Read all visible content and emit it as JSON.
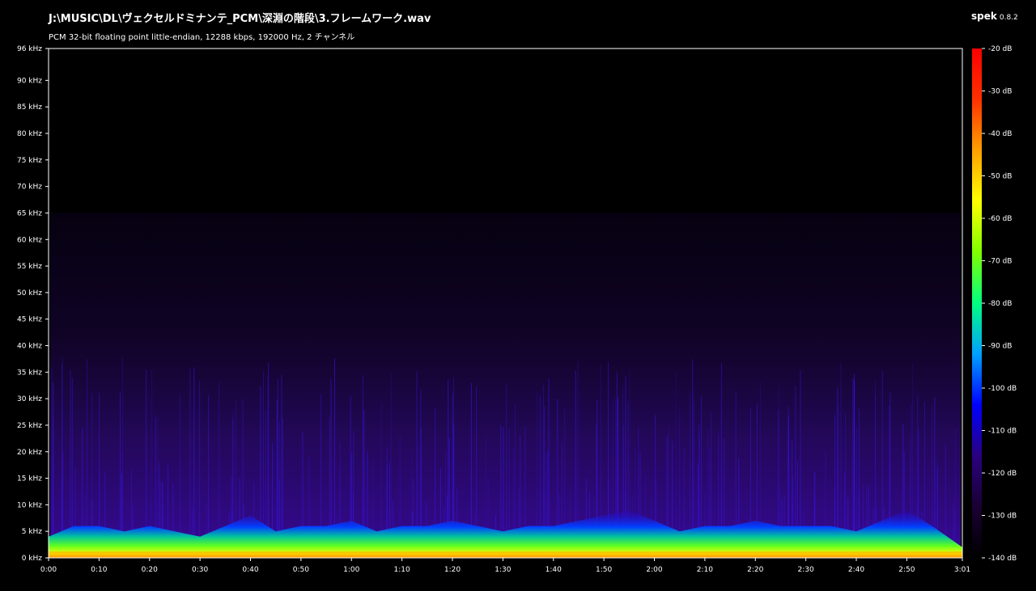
{
  "header": {
    "title": "J:\\MUSIC\\DL\\ヴェクセルドミナンテ_PCM\\深淵の階段\\3.フレームワーク.wav",
    "subtitle": "PCM 32-bit floating point little-endian, 12288 kbps, 192000 Hz, 2 チャンネル",
    "app_name": "spek",
    "app_version": "0.8.2"
  },
  "chart_data": {
    "type": "heatmap",
    "title": "",
    "xlabel": "",
    "ylabel": "",
    "x_unit": "time (m:ss)",
    "y_unit": "kHz",
    "xlim": [
      0,
      181
    ],
    "ylim": [
      0,
      96
    ],
    "x_ticks": [
      {
        "value": 0,
        "label": "0:00"
      },
      {
        "value": 10,
        "label": "0:10"
      },
      {
        "value": 20,
        "label": "0:20"
      },
      {
        "value": 30,
        "label": "0:30"
      },
      {
        "value": 40,
        "label": "0:40"
      },
      {
        "value": 50,
        "label": "0:50"
      },
      {
        "value": 60,
        "label": "1:00"
      },
      {
        "value": 70,
        "label": "1:10"
      },
      {
        "value": 80,
        "label": "1:20"
      },
      {
        "value": 90,
        "label": "1:30"
      },
      {
        "value": 100,
        "label": "1:40"
      },
      {
        "value": 110,
        "label": "1:50"
      },
      {
        "value": 120,
        "label": "2:00"
      },
      {
        "value": 130,
        "label": "2:10"
      },
      {
        "value": 140,
        "label": "2:20"
      },
      {
        "value": 150,
        "label": "2:30"
      },
      {
        "value": 160,
        "label": "2:40"
      },
      {
        "value": 170,
        "label": "2:50"
      },
      {
        "value": 181,
        "label": "3:01"
      }
    ],
    "y_ticks": [
      {
        "value": 0,
        "label": "0 kHz"
      },
      {
        "value": 5,
        "label": "5 kHz"
      },
      {
        "value": 10,
        "label": "10 kHz"
      },
      {
        "value": 15,
        "label": "15 kHz"
      },
      {
        "value": 20,
        "label": "20 kHz"
      },
      {
        "value": 25,
        "label": "25 kHz"
      },
      {
        "value": 30,
        "label": "30 kHz"
      },
      {
        "value": 35,
        "label": "35 kHz"
      },
      {
        "value": 40,
        "label": "40 kHz"
      },
      {
        "value": 45,
        "label": "45 kHz"
      },
      {
        "value": 50,
        "label": "50 kHz"
      },
      {
        "value": 55,
        "label": "55 kHz"
      },
      {
        "value": 60,
        "label": "60 kHz"
      },
      {
        "value": 65,
        "label": "65 kHz"
      },
      {
        "value": 70,
        "label": "70 kHz"
      },
      {
        "value": 75,
        "label": "75 kHz"
      },
      {
        "value": 80,
        "label": "80 kHz"
      },
      {
        "value": 85,
        "label": "85 kHz"
      },
      {
        "value": 90,
        "label": "90 kHz"
      },
      {
        "value": 96,
        "label": "96 kHz"
      }
    ],
    "colorbar": {
      "range_db": [
        -140,
        -20
      ],
      "ticks": [
        {
          "value": -20,
          "label": "-20 dB"
        },
        {
          "value": -30,
          "label": "-30 dB"
        },
        {
          "value": -40,
          "label": "-40 dB"
        },
        {
          "value": -50,
          "label": "-50 dB"
        },
        {
          "value": -60,
          "label": "-60 dB"
        },
        {
          "value": -70,
          "label": "-70 dB"
        },
        {
          "value": -80,
          "label": "-80 dB"
        },
        {
          "value": -90,
          "label": "-90 dB"
        },
        {
          "value": -100,
          "label": "-100 dB"
        },
        {
          "value": -110,
          "label": "-110 dB"
        },
        {
          "value": -120,
          "label": "-120 dB"
        },
        {
          "value": -130,
          "label": "-130 dB"
        },
        {
          "value": -140,
          "label": "-140 dB"
        }
      ],
      "colors": [
        "#000000",
        "#1a0033",
        "#2a0080",
        "#0000ff",
        "#00a0ff",
        "#00ff80",
        "#80ff00",
        "#ffff00",
        "#ffa000",
        "#ff3000",
        "#ff0000"
      ]
    },
    "noise_floor_cutoff_khz": 65,
    "content_band_khz": [
      0,
      10
    ],
    "intensity_envelope": {
      "x": [
        0,
        5,
        10,
        15,
        20,
        25,
        30,
        35,
        40,
        45,
        50,
        55,
        60,
        65,
        70,
        75,
        80,
        85,
        90,
        95,
        100,
        105,
        110,
        115,
        120,
        125,
        130,
        135,
        140,
        145,
        150,
        155,
        160,
        165,
        170,
        175,
        181
      ],
      "top_khz": [
        4,
        6,
        6,
        5,
        6,
        5,
        4,
        6,
        8,
        5,
        6,
        6,
        7,
        5,
        6,
        6,
        7,
        6,
        5,
        6,
        6,
        7,
        8,
        9,
        7,
        5,
        6,
        6,
        7,
        6,
        6,
        6,
        5,
        7,
        9,
        6,
        2
      ]
    }
  }
}
